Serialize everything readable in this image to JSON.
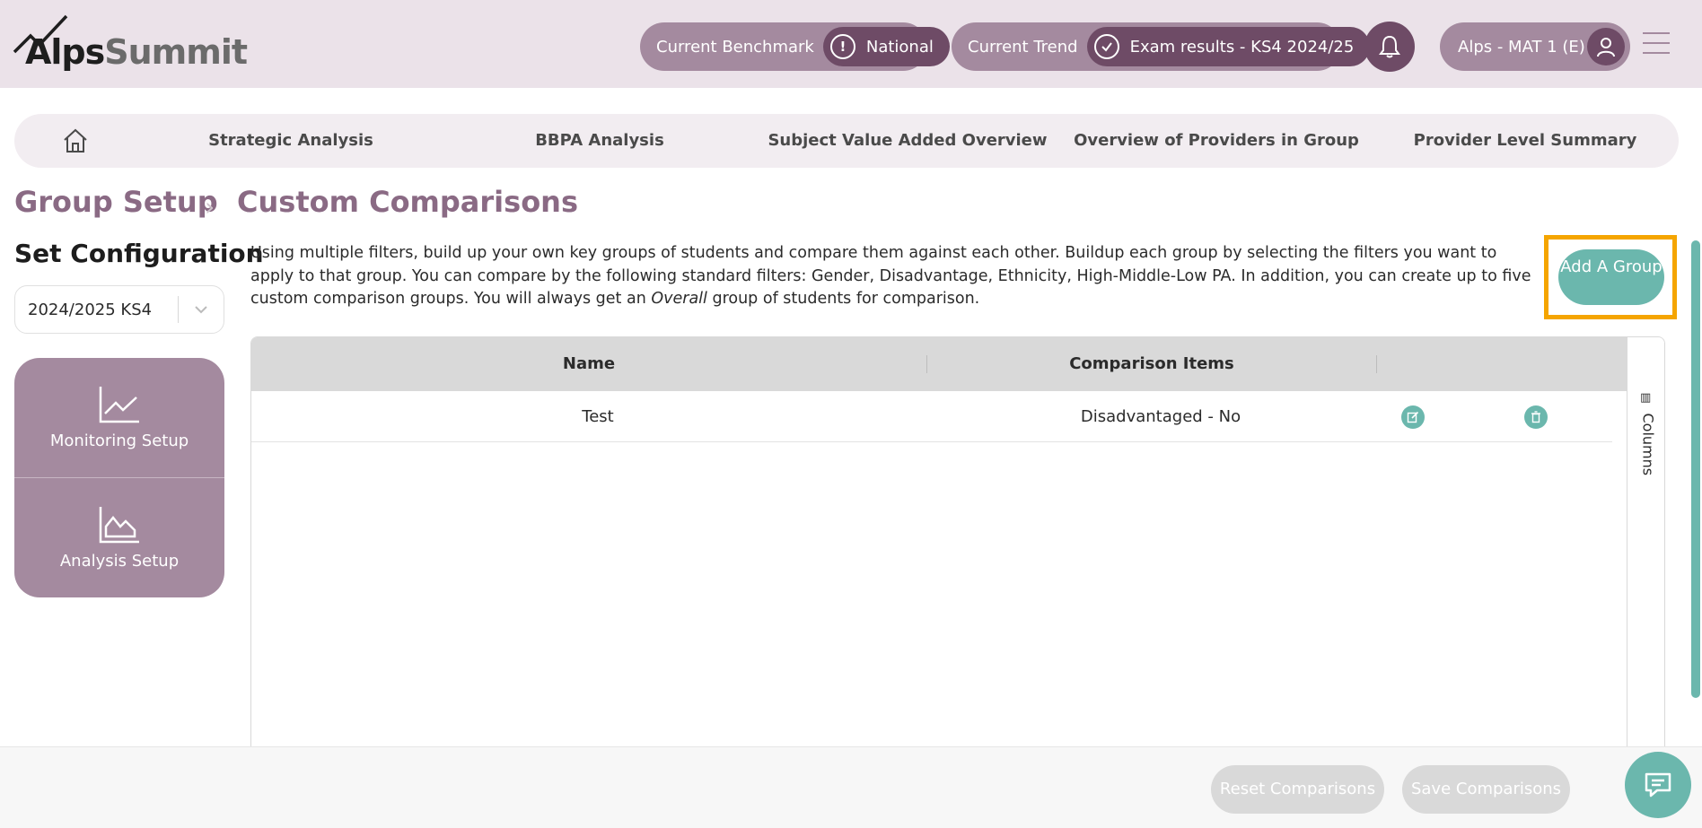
{
  "header": {
    "logo_alps": "Alps",
    "logo_summit": "Summit",
    "benchmark_label": "Current Benchmark",
    "benchmark_value": "National",
    "trend_label": "Current Trend",
    "trend_value": "Exam results - KS4 2024/25",
    "account_label": "Alps - MAT 1 (E)"
  },
  "nav": {
    "items": [
      {
        "label": "Strategic Analysis"
      },
      {
        "label": "BBPA Analysis"
      },
      {
        "label": "Subject Value Added Overview"
      },
      {
        "label": "Overview of Providers in Group"
      },
      {
        "label": "Provider Level Summary"
      }
    ]
  },
  "breadcrumb": {
    "parent": "Group Setup",
    "separator": "›",
    "current": "Custom Comparisons"
  },
  "sidebar": {
    "title": "Set Configuration",
    "year_value": "2024/2025 KS4",
    "buttons": [
      {
        "label": "Monitoring Setup"
      },
      {
        "label": "Analysis Setup"
      }
    ]
  },
  "main": {
    "description_1": "Using multiple filters, build up your own key groups of students and compare them against each other. Buildup each group by selecting the filters you want to apply to that group. You can compare by the following standard filters: Gender, Disadvantage, Ethnicity, High-Middle-Low PA. In addition, you can create up to five custom comparison groups. You will always get an ",
    "description_em": "Overall",
    "description_2": " group of students for comparison.",
    "add_button": "Add A Group"
  },
  "table": {
    "columns": [
      "Name",
      "Comparison Items"
    ],
    "rows": [
      {
        "name": "Test",
        "items": "Disadvantaged - No"
      }
    ],
    "columns_toggle": "Columns"
  },
  "footer": {
    "reset_label": "Reset Comparisons",
    "save_label": "Save Comparisons"
  },
  "colors": {
    "brand_purple": "#a48a9f",
    "brand_dark_purple": "#6e4b66",
    "accent_teal": "#6bb7ad",
    "highlight_orange": "#f5a500"
  },
  "icons": [
    "alps-logo-icon",
    "alert-icon",
    "check-circle-icon",
    "bell-icon",
    "user-icon",
    "hamburger-icon",
    "home-icon",
    "chevron-down-icon",
    "line-chart-icon",
    "area-chart-icon",
    "edit-icon",
    "trash-icon",
    "columns-icon",
    "chat-icon"
  ]
}
